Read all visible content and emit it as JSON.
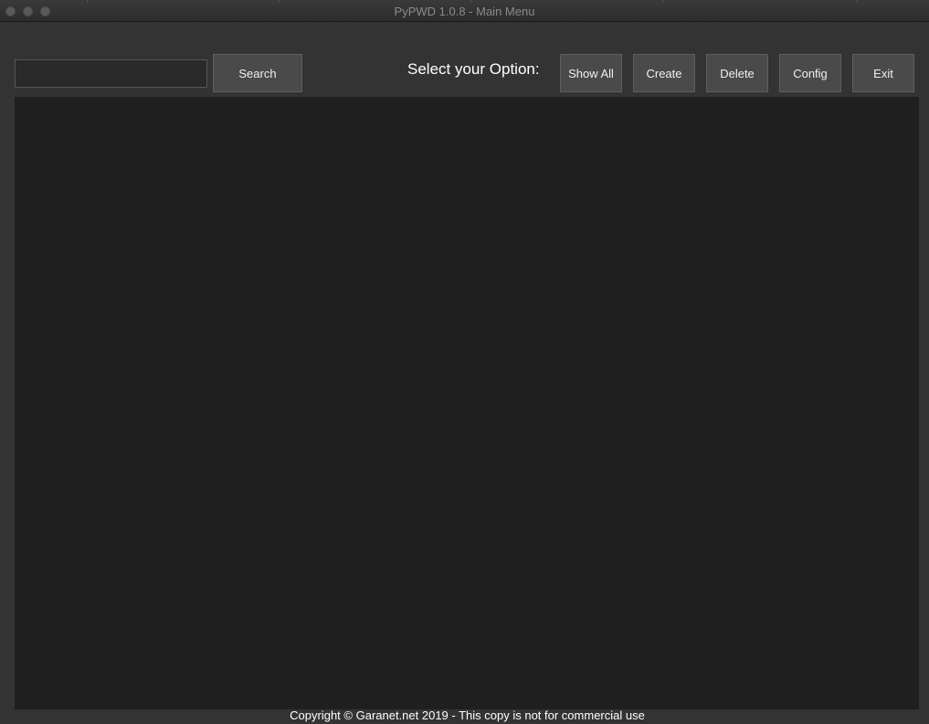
{
  "window": {
    "title": "PyPWD 1.0.8 - Main Menu"
  },
  "toolbar": {
    "search_value": "",
    "search_label": "Search",
    "option_label": "Select your Option:",
    "show_all_label": "Show All",
    "create_label": "Create",
    "delete_label": "Delete",
    "config_label": "Config",
    "exit_label": "Exit"
  },
  "results": {
    "items": []
  },
  "footer": {
    "copyright": "Copyright © Garanet.net 2019 - This copy is not for commercial use"
  },
  "colors": {
    "window_bg": "#333333",
    "results_bg": "#1f1f1f",
    "button_bg": "#4a4a4a",
    "text": "#ffffff"
  }
}
